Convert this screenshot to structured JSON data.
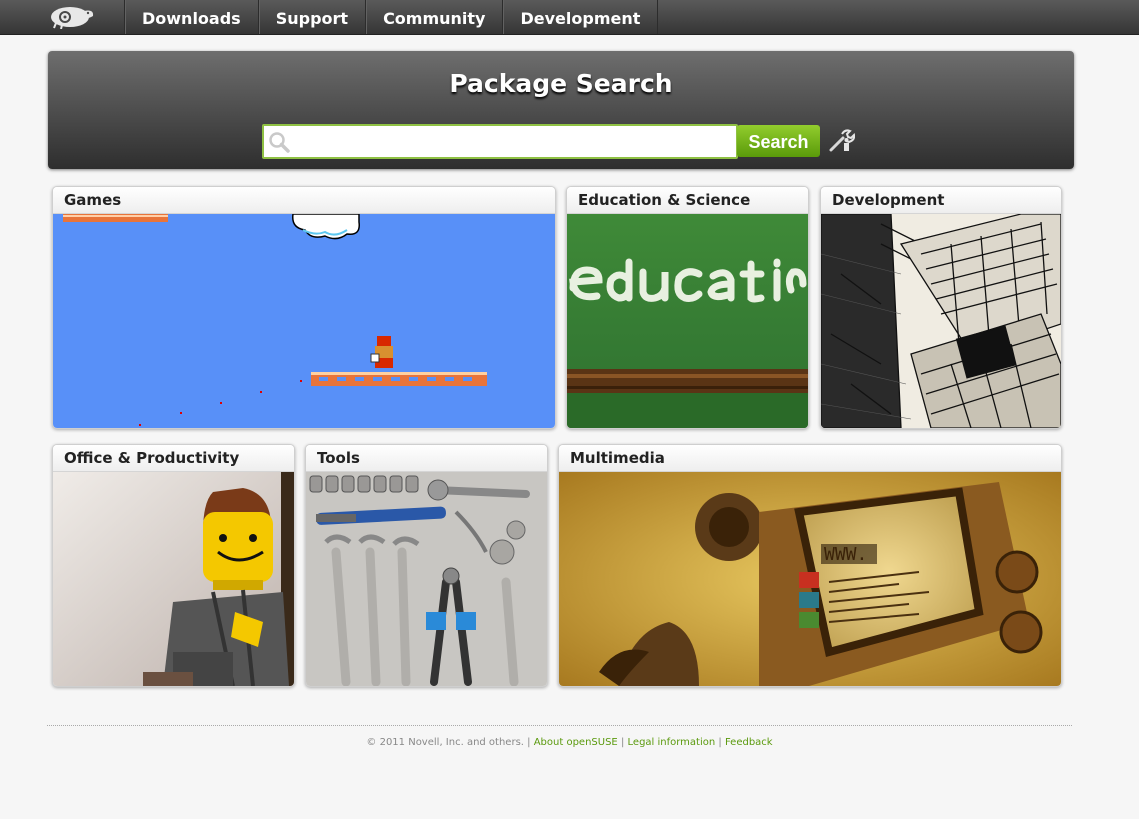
{
  "nav": {
    "logo_icon": "opensuse-chameleon-icon",
    "items": [
      {
        "label": "Downloads"
      },
      {
        "label": "Support"
      },
      {
        "label": "Community"
      },
      {
        "label": "Development"
      }
    ]
  },
  "search": {
    "title": "Package Search",
    "query": "",
    "button_label": "Search",
    "advanced_icon": "tools-icon",
    "accent_color": "#7ab51d"
  },
  "categories": [
    {
      "title": "Games",
      "image": "retro-platformer-screenshot"
    },
    {
      "title": "Education & Science",
      "image": "chalkboard-education"
    },
    {
      "title": "Development",
      "image": "sketch-laptop"
    },
    {
      "title": "Office & Productivity",
      "image": "lego-office-worker"
    },
    {
      "title": "Tools",
      "image": "tools-on-table"
    },
    {
      "title": "Multimedia",
      "image": "retro-computer-web"
    }
  ],
  "footer": {
    "copyright": "© 2011 Novell, Inc. and others.",
    "links": [
      {
        "label": "About openSUSE"
      },
      {
        "label": "Legal information"
      },
      {
        "label": "Feedback"
      }
    ],
    "link_color": "#5b9a0e"
  }
}
